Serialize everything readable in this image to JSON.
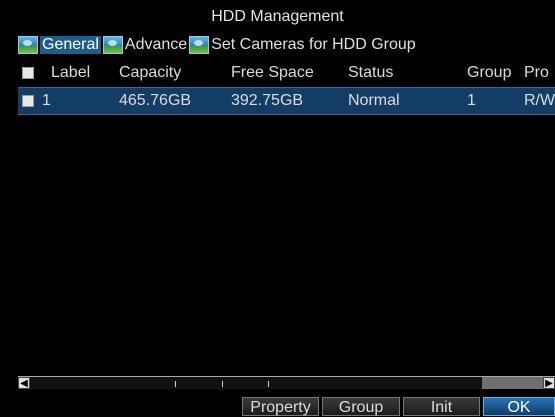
{
  "window": {
    "title": "HDD Management"
  },
  "tabs": [
    {
      "label": "General",
      "active": true,
      "icon": "camera-icon"
    },
    {
      "label": "Advance",
      "active": false,
      "icon": "camera-icon"
    },
    {
      "label": "Set Cameras for HDD Group",
      "active": false,
      "icon": "camera-icon"
    }
  ],
  "table": {
    "columns": [
      "Label",
      "Capacity",
      "Free Space",
      "Status",
      "Group",
      "Pro"
    ],
    "rows": [
      {
        "label": "1",
        "capacity": "465.76GB",
        "free_space": "392.75GB",
        "status": "Normal",
        "group": "1",
        "property": "R/W"
      }
    ]
  },
  "buttons": {
    "property": "Property",
    "group": "Group",
    "init": "Init",
    "ok": "OK"
  },
  "colors": {
    "selected_row": "#143d66",
    "primary_button": "#1e5e96"
  }
}
